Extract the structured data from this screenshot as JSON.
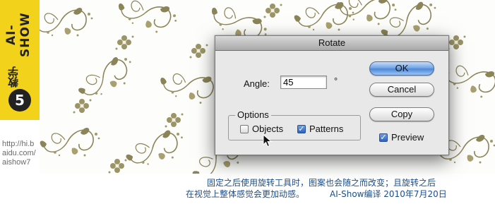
{
  "side_tab": {
    "brand": "AI-SHOW",
    "series": "教学",
    "number": "5",
    "url_lines": [
      "http://hi.b",
      "aidu.com/",
      "aishow7"
    ]
  },
  "dialog": {
    "title": "Rotate",
    "angle_label": "Angle:",
    "angle_value": "45",
    "degree_symbol": "°",
    "options_legend": "Options",
    "objects_label": "Objects",
    "objects_checked": false,
    "patterns_label": "Patterns",
    "patterns_checked": true,
    "ok_label": "OK",
    "cancel_label": "Cancel",
    "copy_label": "Copy",
    "preview_label": "Preview",
    "preview_checked": true
  },
  "caption": {
    "line1": "固定之后使用旋转工具时，图案也会随之而改变；且旋转之后",
    "line2": "在视觉上整体感觉会更加动感。",
    "credit": "AI-Show编译 2010年7月20日"
  },
  "colors": {
    "tab_yellow": "#f2d21a",
    "pattern_olive": "#8a8458",
    "caption_blue": "#1e4f8a",
    "primary_button": "#4a86d8"
  }
}
